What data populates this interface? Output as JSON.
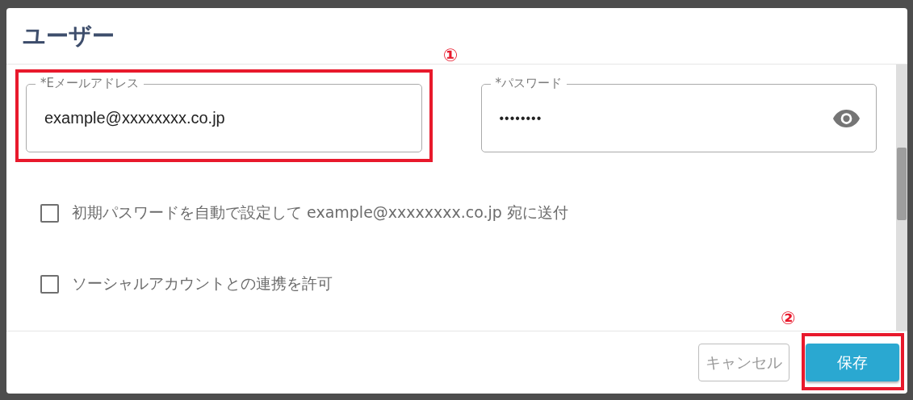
{
  "dialog": {
    "title": "ユーザー"
  },
  "fields": [
    {
      "kind": "text",
      "label": "*Eメールアドレス",
      "value": "example@xxxxxxxx.co.jp",
      "highlighted": true,
      "callout": "①"
    },
    {
      "kind": "password",
      "label": "*パスワード",
      "value": "••••••••",
      "highlighted": false
    }
  ],
  "checkboxes": [
    {
      "label": "初期パスワードを自動で設定して example@xxxxxxxx.co.jp 宛に送付",
      "checked": false
    },
    {
      "label": "ソーシャルアカウントとの連携を許可",
      "checked": false
    }
  ],
  "buttons": [
    {
      "kind": "secondary",
      "label": "キャンセル",
      "highlighted": false
    },
    {
      "kind": "primary",
      "label": "保存",
      "highlighted": true,
      "callout": "②"
    }
  ]
}
